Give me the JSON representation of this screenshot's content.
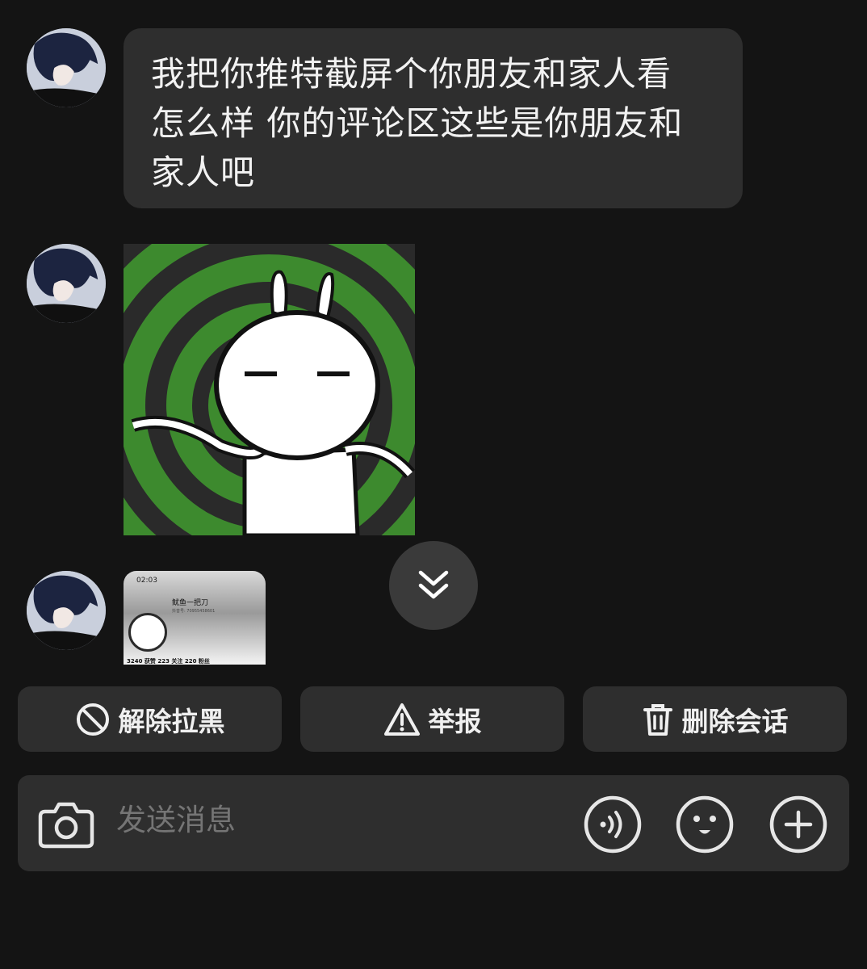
{
  "messages": [
    {
      "type": "text",
      "text_lines": [
        "我把你推特截屏个你朋友和家人看",
        "怎么样 你的评论区这些是你朋友和",
        "家人吧"
      ]
    },
    {
      "type": "sticker",
      "icon": "tuzki-sticker"
    },
    {
      "type": "screenshot",
      "preview": {
        "time": "02:03",
        "handle": "鱿鱼一把刀",
        "id_text": "抖音号: 70955458601",
        "stats": "3240 获赞   223 关注   220 粉丝"
      }
    }
  ],
  "actions": {
    "unblock_label": "解除拉黑",
    "report_label": "举报",
    "delete_label": "删除会话"
  },
  "composer": {
    "placeholder": "发送消息"
  },
  "colors": {
    "background": "#141414",
    "bubble": "#2e2e2e",
    "sticker_green": "#3d8a2e"
  }
}
